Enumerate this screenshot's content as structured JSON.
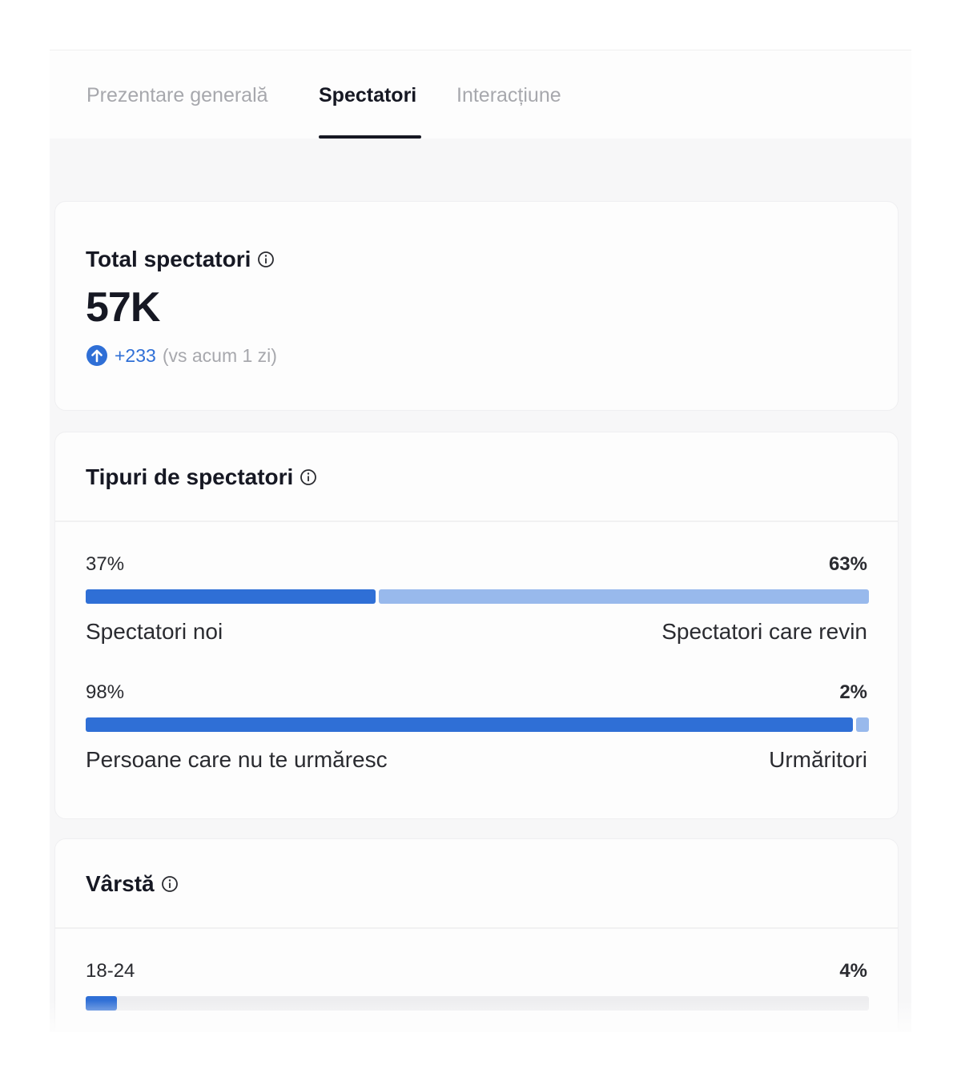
{
  "tabs": [
    {
      "label": "Prezentare generală",
      "active": false
    },
    {
      "label": "Spectatori",
      "active": true
    },
    {
      "label": "Interacțiune",
      "active": false
    }
  ],
  "total_viewers": {
    "title": "Total spectatori",
    "value": "57K",
    "delta": "+233",
    "delta_note": "(vs acum 1 zi)",
    "delta_icon": "arrow-up-circle-icon"
  },
  "viewer_types": {
    "title": "Tipuri de spectatori",
    "rows": [
      {
        "left_pct": "37%",
        "right_pct": "63%",
        "left_label": "Spectatori noi",
        "right_label": "Spectatori care revin",
        "left_fraction": 0.37
      },
      {
        "left_pct": "98%",
        "right_pct": "2%",
        "left_label": "Persoane care nu te urmăresc",
        "right_label": "Urmăritori",
        "left_fraction": 0.98
      }
    ]
  },
  "age": {
    "title": "Vârstă",
    "rows": [
      {
        "label": "18-24",
        "pct": "4%",
        "fraction": 0.04
      }
    ]
  },
  "colors": {
    "primary_bar": "#2f6fd6",
    "secondary_bar": "#98b9ec",
    "track": "#ededef"
  }
}
